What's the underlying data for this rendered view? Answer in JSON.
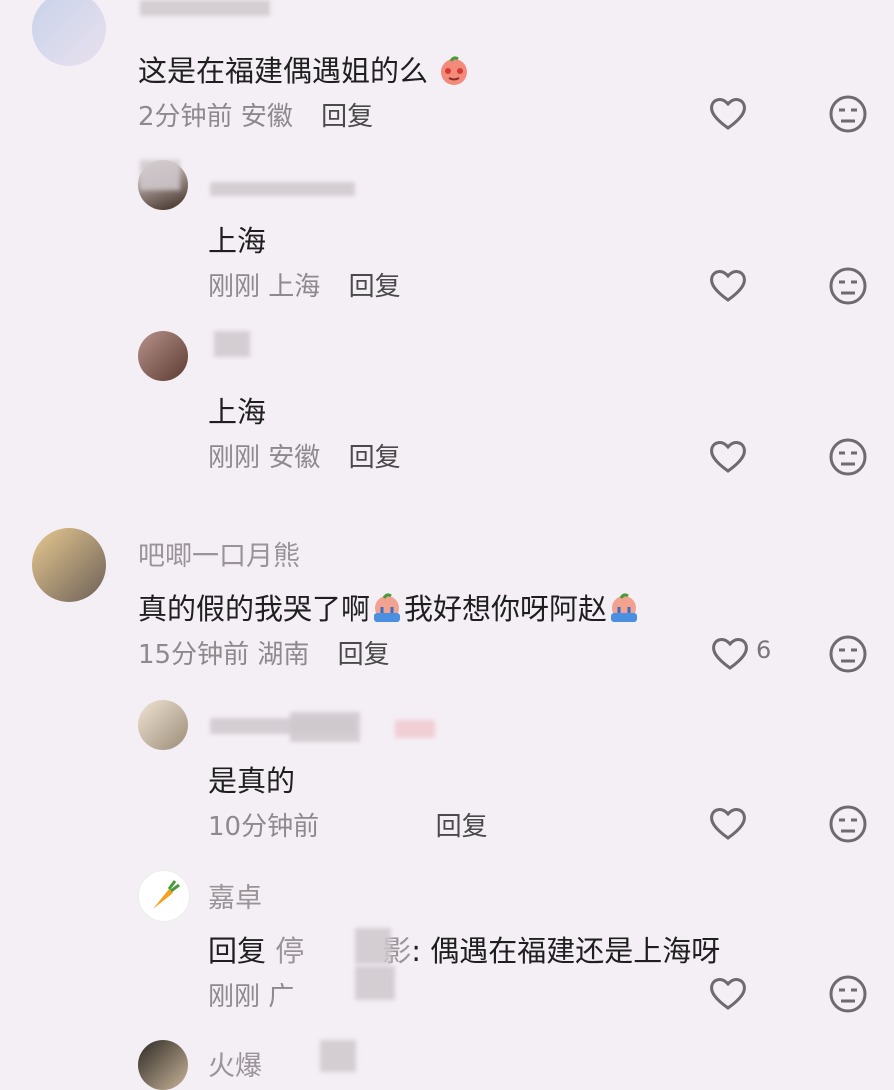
{
  "comments": [
    {
      "name": "",
      "text": "这是在福建偶遇姐的么",
      "time": "2分钟前",
      "location": "安徽",
      "reply_label": "回复",
      "likes": ""
    },
    {
      "name": "",
      "text": "上海",
      "time": "刚刚",
      "location": "上海",
      "reply_label": "回复"
    },
    {
      "name": "",
      "text": "上海",
      "time": "刚刚",
      "location": "安徽",
      "reply_label": "回复"
    },
    {
      "name": "吧唧一口月熊",
      "text_part1": "真的假的我哭了啊",
      "text_part2": "我好想你呀阿赵",
      "time": "15分钟前",
      "location": "湖南",
      "reply_label": "回复",
      "likes": "6"
    },
    {
      "name": "",
      "text": "是真的",
      "time": "10分钟前",
      "reply_label": "回复"
    },
    {
      "name": "嘉卓",
      "reply_prefix": "回复",
      "reply_target_a": "停",
      "reply_target_b": "影",
      "text": ": 偶遇在福建还是上海呀",
      "time": "刚刚",
      "location_partial": "广",
      "reply_label": ""
    },
    {
      "name": "火爆"
    }
  ],
  "icons": {
    "like": "heart-outline-icon",
    "dislike": "neutral-face-icon"
  },
  "colors": {
    "background": "#f4eff5",
    "meta_text": "#8e898d",
    "icon_stroke": "#6f6a6e"
  }
}
